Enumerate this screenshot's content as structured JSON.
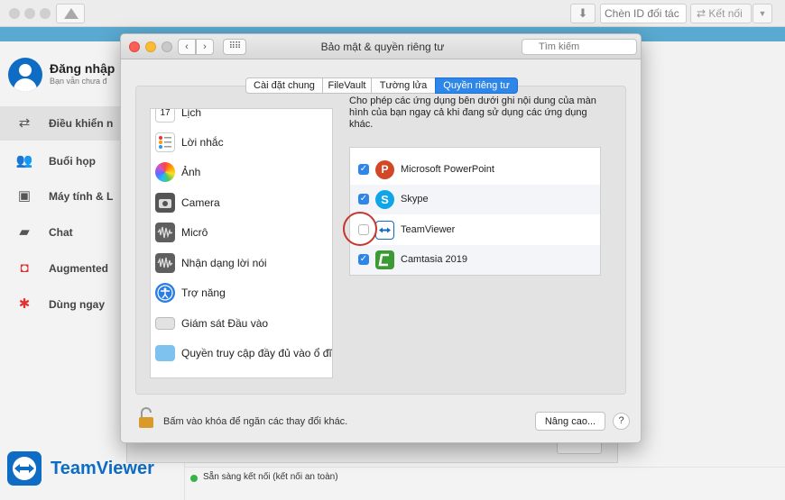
{
  "teamviewer": {
    "partner_id_placeholder": "Chèn ID đối tác",
    "connect_label": "Kết nối",
    "login_title": "Đăng nhập",
    "login_subtitle": "Bạn vẫn chưa đ",
    "nav": [
      {
        "label": "Điều khiển n",
        "icon": "arrows-icon"
      },
      {
        "label": "Buổi họp",
        "icon": "meeting-icon"
      },
      {
        "label": "Máy tính & L",
        "icon": "computers-icon"
      },
      {
        "label": "Chat",
        "icon": "chat-icon"
      },
      {
        "label": "Augmented",
        "icon": "augmented-icon"
      },
      {
        "label": "Dùng ngay",
        "icon": "bulb-icon"
      }
    ],
    "brand": "TeamViewer",
    "status": "Sẵn sàng kết nối (kết nối an toàn)"
  },
  "prefs": {
    "title": "Bảo mật & quyền riêng tư",
    "search_placeholder": "Tìm kiếm",
    "tabs": [
      "Cài đặt chung",
      "FileVault",
      "Tường lửa",
      "Quyền riêng tư"
    ],
    "selected_tab": "Quyền riêng tư",
    "categories": [
      {
        "label": "Lịch",
        "icon": "calendar-icon",
        "badge": "17"
      },
      {
        "label": "Lời nhắc",
        "icon": "reminders-icon"
      },
      {
        "label": "Ảnh",
        "icon": "photos-icon"
      },
      {
        "label": "Camera",
        "icon": "camera-icon"
      },
      {
        "label": "Micrô",
        "icon": "microphone-icon"
      },
      {
        "label": "Nhận dạng lời nói",
        "icon": "speech-recognition-icon"
      },
      {
        "label": "Trợ năng",
        "icon": "accessibility-icon"
      },
      {
        "label": "Giám sát Đầu vào",
        "icon": "input-monitoring-icon"
      },
      {
        "label": "Quyền truy cập đầy đủ vào ổ đĩa",
        "icon": "folder-icon"
      }
    ],
    "description": "Cho phép các ứng dụng bên dưới ghi nội dung của màn hình của bạn ngay cả khi đang sử dụng các ứng dụng khác.",
    "apps": [
      {
        "name": "Microsoft PowerPoint",
        "checked": true,
        "icon": "powerpoint-icon"
      },
      {
        "name": "Skype",
        "checked": true,
        "icon": "skype-icon"
      },
      {
        "name": "TeamViewer",
        "checked": false,
        "icon": "teamviewer-icon"
      },
      {
        "name": "Camtasia 2019",
        "checked": true,
        "icon": "camtasia-icon"
      }
    ],
    "lock_text": "Bấm vào khóa để ngăn các thay đổi khác.",
    "advanced_label": "Nâng cao...",
    "help_label": "?"
  }
}
